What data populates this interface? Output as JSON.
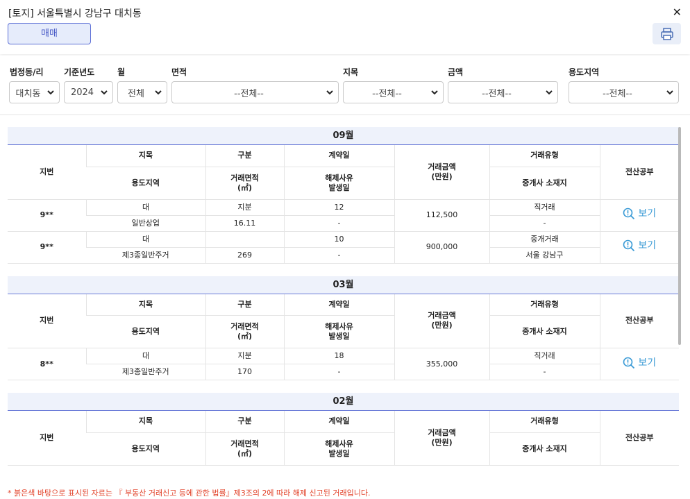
{
  "header": {
    "title": "[토지] 서울특별시 강남구 대치동",
    "close_icon": "close-icon",
    "tab_label": "매매",
    "print_icon": "print-icon"
  },
  "filters": [
    {
      "label": "법정동/리",
      "value": "대치동"
    },
    {
      "label": "기준년도",
      "value": "2024"
    },
    {
      "label": "월",
      "value": "전체"
    },
    {
      "label": "면적",
      "value": "--전체--"
    },
    {
      "label": "지목",
      "value": "--전체--"
    },
    {
      "label": "금액",
      "value": "--전체--"
    },
    {
      "label": "용도지역",
      "value": "--전체--"
    }
  ],
  "columns": {
    "jibeon": "지번",
    "jimok": "지목",
    "gubun": "구분",
    "contract_date": "계약일",
    "price": "거래금액\n(만원)",
    "deal_type": "거래유형",
    "docs": "전산공부",
    "zone": "용도지역",
    "area": "거래면적\n(㎡)",
    "cancel": "해제사유\n발생일",
    "broker": "중개사 소재지"
  },
  "months": [
    {
      "label": "09월",
      "rows": [
        {
          "jibeon": "9**",
          "jimok": "대",
          "gubun": "지분",
          "contract_day": "12",
          "price": "112,500",
          "deal_type": "직거래",
          "zone": "일반상업",
          "area": "16.11",
          "cancel": "-",
          "broker": "-",
          "view_label": "보기"
        },
        {
          "jibeon": "9**",
          "jimok": "대",
          "gubun": "",
          "contract_day": "10",
          "price": "900,000",
          "deal_type": "중개거래",
          "zone": "제3종일반주거",
          "area": "269",
          "cancel": "-",
          "broker": "서울 강남구",
          "view_label": "보기"
        }
      ]
    },
    {
      "label": "03월",
      "rows": [
        {
          "jibeon": "8**",
          "jimok": "대",
          "gubun": "지분",
          "contract_day": "18",
          "price": "355,000",
          "deal_type": "직거래",
          "zone": "제3종일반주거",
          "area": "170",
          "cancel": "-",
          "broker": "-",
          "view_label": "보기"
        }
      ]
    },
    {
      "label": "02월",
      "rows": []
    }
  ],
  "footnote": "* 붉은색 바탕으로 표시된 자료는 『 부동산 거래신고 등에 관한 법률』제3조의 2에 따라 해제 신고된 거래입니다.",
  "colors": {
    "accent": "#5c6fd6",
    "tab_bg": "#e6ecfb",
    "month_bg": "#eef2fb",
    "link": "#3b9bd6",
    "note": "#e2442b"
  }
}
